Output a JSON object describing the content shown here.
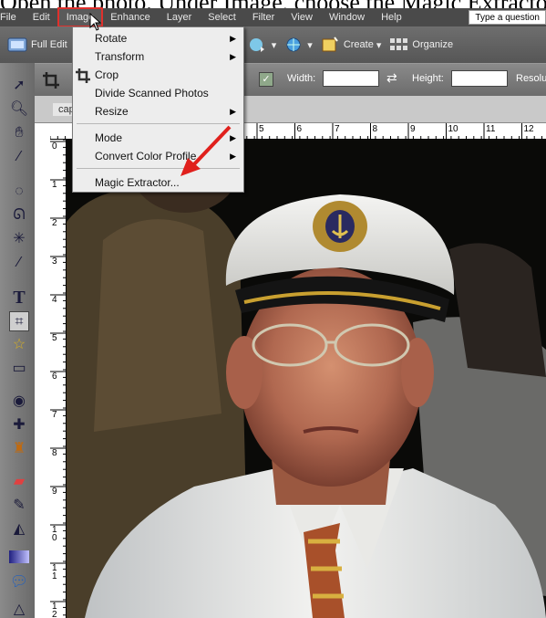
{
  "caption": "Open the photo. Under Image, choose the Magic Extractor",
  "menubar": {
    "items": [
      "File",
      "Edit",
      "Image",
      "Enhance",
      "Layer",
      "Select",
      "Filter",
      "View",
      "Window",
      "Help"
    ],
    "active": "Image",
    "question_box": "Type a question"
  },
  "toolbar": {
    "full_edit": "Full Edit",
    "create": "Create",
    "organize": "Organize"
  },
  "options_bar": {
    "width_label": "Width:",
    "height_label": "Height:",
    "resolution_label": "Resolution"
  },
  "document": {
    "tab_label": "cap"
  },
  "rulers": {
    "top": [
      "5",
      "6",
      "7",
      "8",
      "9",
      "10",
      "11",
      "12"
    ],
    "left": [
      "0",
      "1",
      "2",
      "3",
      "4",
      "5",
      "6",
      "7",
      "8",
      "9",
      "10",
      "11",
      "12"
    ]
  },
  "image_menu": {
    "items": [
      "Rotate",
      "Transform",
      "Crop",
      "Divide Scanned Photos",
      "Resize",
      "Mode",
      "Convert Color Profile",
      "Magic Extractor..."
    ]
  },
  "colors": {
    "menubar_bg": "#4a4a4a",
    "highlight_box": "#e0302c",
    "annotation_arrow": "#e0201c"
  },
  "icons": [
    "move-icon",
    "zoom-icon",
    "hand-icon",
    "eyedropper-icon",
    "marquee-icon",
    "lasso-icon",
    "magic-wand-icon",
    "brush-selection-icon",
    "type-icon",
    "crop-icon",
    "cookie-cutter-icon",
    "straighten-icon",
    "red-eye-icon",
    "healing-icon",
    "clone-stamp-icon",
    "eraser-icon",
    "pencil-icon",
    "paint-bucket-icon",
    "gradient-icon",
    "shape-icon"
  ]
}
